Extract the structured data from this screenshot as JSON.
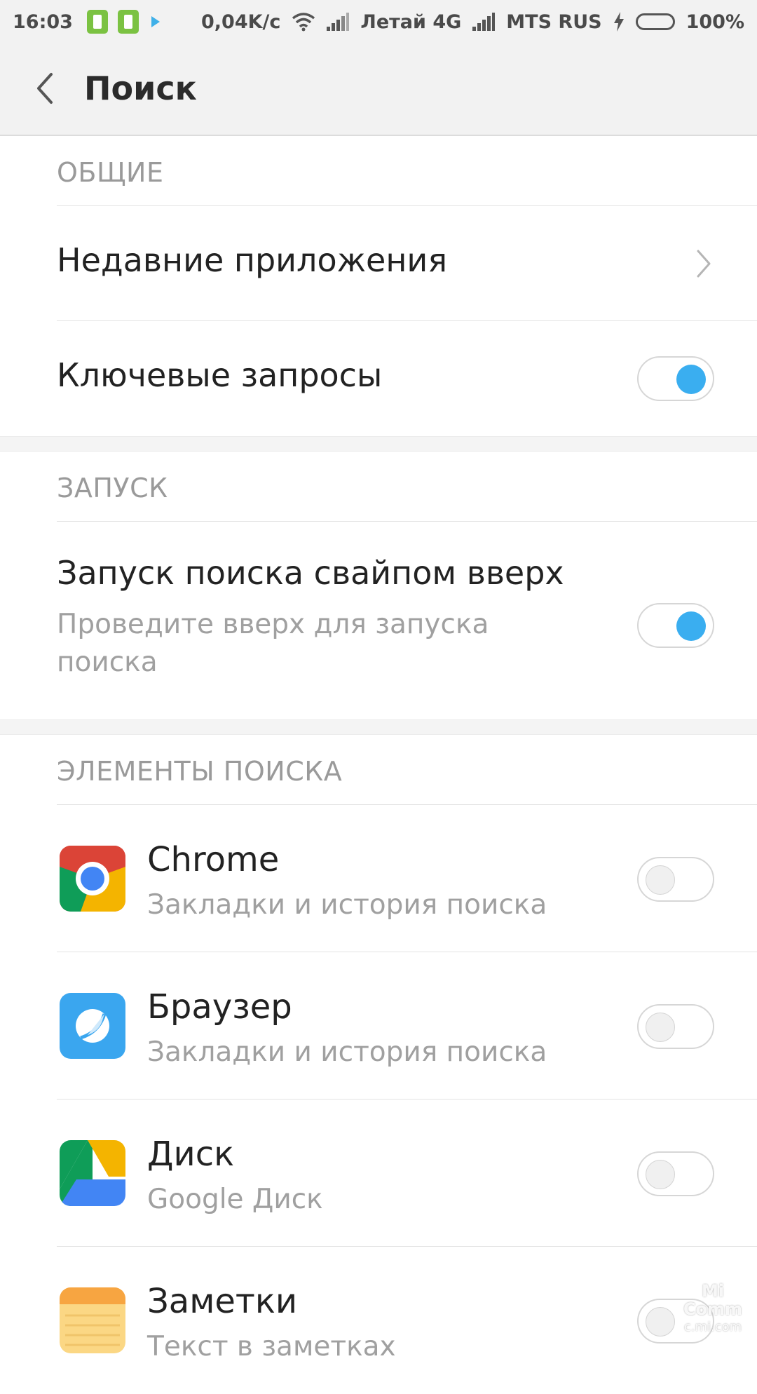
{
  "status_bar": {
    "time": "16:03",
    "net_speed": "0,04K/с",
    "carrier1": "Летай 4G",
    "carrier2": "MTS RUS",
    "battery": "100%",
    "battery_level": 1.0,
    "notification_icons": [
      "battery-saver-icon",
      "battery-saver-icon",
      "play-store-icon"
    ],
    "accent_battery": "#6ecb3a"
  },
  "header": {
    "title": "Поиск",
    "back_icon": "chevron-left-icon"
  },
  "sections": {
    "general": {
      "label": "ОБЩИЕ",
      "recent_apps": {
        "title": "Недавние приложения",
        "icon": "chevron-right-icon"
      },
      "key_queries": {
        "title": "Ключевые запросы",
        "enabled": true
      }
    },
    "launch": {
      "label": "ЗАПУСК",
      "swipe_up": {
        "title": "Запуск поиска свайпом вверх",
        "subtitle": "Проведите вверх для запуска поиска",
        "enabled": true
      }
    },
    "search_items": {
      "label": "ЭЛЕМЕНТЫ ПОИСКА",
      "apps": [
        {
          "name": "Chrome",
          "subtitle": "Закладки и история поиска",
          "icon": "chrome-icon",
          "enabled": false
        },
        {
          "name": "Браузер",
          "subtitle": "Закладки и история поиска",
          "icon": "browser-icon",
          "enabled": false
        },
        {
          "name": "Диск",
          "subtitle": "Google Диск",
          "icon": "google-drive-icon",
          "enabled": false
        },
        {
          "name": "Заметки",
          "subtitle": "Текст в заметках",
          "icon": "notes-icon",
          "enabled": false
        }
      ]
    }
  },
  "colors": {
    "toggle_on": "#3aaef0",
    "header_bg": "#f2f2f2",
    "secondary_text": "#a0a0a0"
  },
  "watermark": {
    "line1": "Mi Comm",
    "line2": "c.mi.com"
  }
}
